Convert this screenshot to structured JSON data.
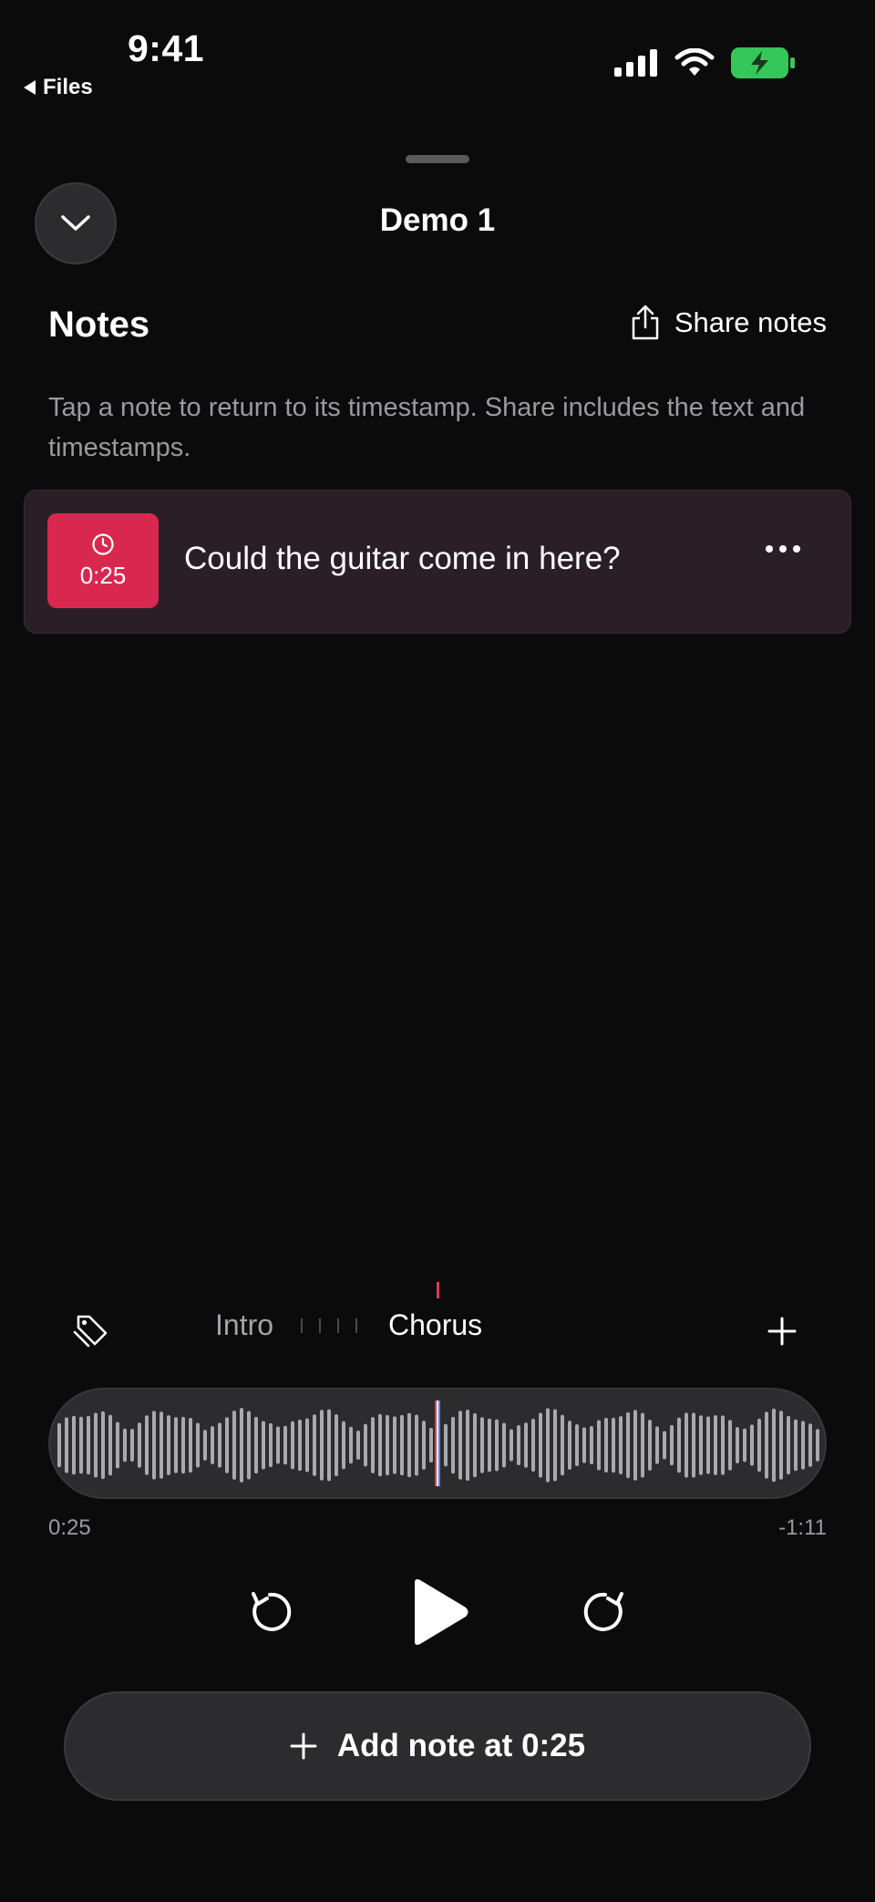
{
  "status_bar": {
    "time": "9:41",
    "back_label": "Files"
  },
  "sheet": {
    "title": "Demo 1"
  },
  "notes": {
    "heading": "Notes",
    "share_label": "Share notes",
    "help_text": "Tap a note to return to its timestamp. Share includes the text and timestamps.",
    "items": [
      {
        "timestamp": "0:25",
        "text": "Could the guitar come in here?"
      }
    ]
  },
  "markers": {
    "items": [
      "Intro",
      "Chorus"
    ],
    "active": "Chorus"
  },
  "playback": {
    "elapsed": "0:25",
    "remaining": "-1:11",
    "add_note_label": "Add note at 0:25"
  },
  "colors": {
    "accent_red": "#d9284f",
    "battery_green": "#34c759",
    "background": "#0b0b0c"
  }
}
